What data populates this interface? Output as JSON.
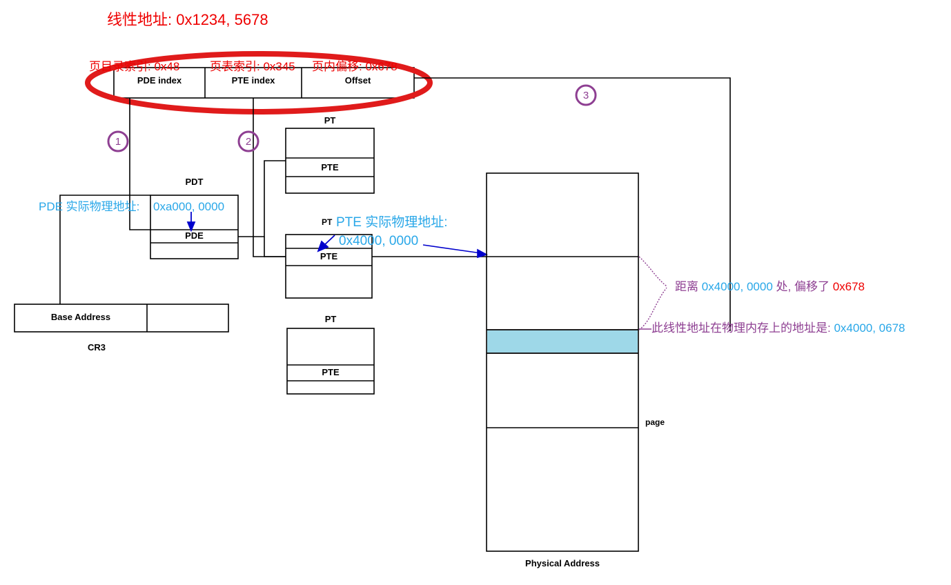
{
  "diagram": {
    "title": "线性地址: 0x1234, 5678",
    "linear_address": {
      "fields": [
        {
          "annotation": "页目录索引: 0x48",
          "label": "PDE index"
        },
        {
          "annotation": "页表索引: 0x345",
          "label": "PTE index"
        },
        {
          "annotation": "页内偏移: 0x678",
          "label": "Offset"
        }
      ]
    },
    "steps": [
      {
        "number": "1"
      },
      {
        "number": "2"
      },
      {
        "number": "3"
      }
    ],
    "cr3": {
      "caption": "CR3",
      "base_address_label": "Base Address"
    },
    "pdt": {
      "title": "PDT",
      "entry_label": "PDE",
      "annotation_label": "PDE 实际物理地址:",
      "annotation_value": "0xa000, 0000"
    },
    "page_tables": [
      {
        "title": "PT",
        "entry_label": "PTE"
      },
      {
        "title": "PT",
        "entry_label": "PTE",
        "annotation_label": "PTE 实际物理地址:",
        "annotation_value": "0x4000, 0000"
      },
      {
        "title": "PT",
        "entry_label": "PTE"
      }
    ],
    "physical": {
      "caption": "Physical Address",
      "page_label": "page",
      "highlight_color": "#9ed8e8"
    },
    "notes": {
      "offset_note_prefix": "距离 ",
      "offset_note_base": "0x4000, 0000",
      "offset_note_middle": " 处, 偏移了 ",
      "offset_note_value": "0x678",
      "result_note_label": "此线性地址在物理内存上的地址是: ",
      "result_note_value": "0x4000, 0678"
    },
    "colors": {
      "red": "#ee0000",
      "cyan": "#29a7e8",
      "purple": "#8e3f92",
      "blue_arrow": "#0000cc",
      "highlight": "#9ed8e8"
    }
  }
}
